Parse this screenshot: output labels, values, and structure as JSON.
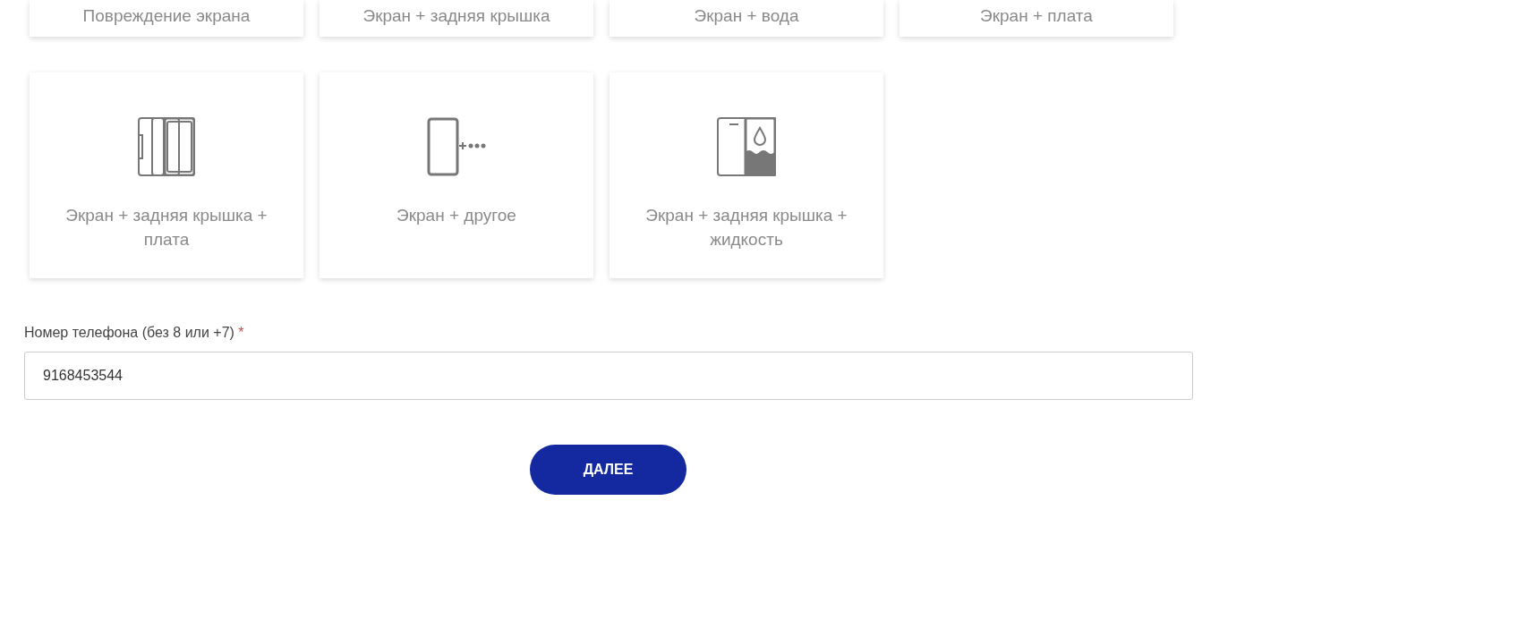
{
  "top_cards": [
    {
      "label": "Повреждение экрана"
    },
    {
      "label": "Экран + задняя крышка"
    },
    {
      "label": "Экран + вода"
    },
    {
      "label": "Экран + плата"
    }
  ],
  "cards": [
    {
      "kind": "stack",
      "label": "Экран + задняя крышка + плата"
    },
    {
      "kind": "other",
      "label": "Экран + другое"
    },
    {
      "kind": "liquid",
      "label": "Экран + задняя крышка + жидкость"
    }
  ],
  "phone_field": {
    "label": "Номер телефона (без 8 или +7)",
    "required_mark": "*",
    "value": "9168453544"
  },
  "next_button": {
    "label": "ДАЛЕЕ"
  }
}
